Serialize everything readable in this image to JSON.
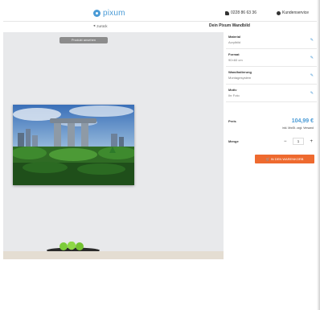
{
  "header": {
    "logo_text": "pixum",
    "phone": "0228 86 63 36",
    "account": "Kundenservice"
  },
  "subnav": {
    "back_label": "zurück",
    "page_title": "Dein Pixum Wandbild"
  },
  "preview": {
    "preview_button": "Produkt ansehen"
  },
  "options": [
    {
      "title": "Material",
      "value": "Acrylbild",
      "edit": "✎"
    },
    {
      "title": "Format",
      "value": "90×60 cm",
      "edit": "✎"
    },
    {
      "title": "Wandhalterung",
      "value": "Montagesystem",
      "edit": "✎"
    },
    {
      "title": "Motiv",
      "value": "Ihr Foto",
      "edit": "✎"
    }
  ],
  "pricing": {
    "label": "Preis",
    "price": "104,99 €",
    "note": "inkl. MwSt. zzgl. Versand"
  },
  "quantity": {
    "label": "Menge",
    "minus": "−",
    "value": "1",
    "plus": "+"
  },
  "cart": {
    "button": "IN DEN WARENKORB"
  },
  "colors": {
    "accent": "#4a9bd6",
    "cta": "#ee6a2f"
  }
}
